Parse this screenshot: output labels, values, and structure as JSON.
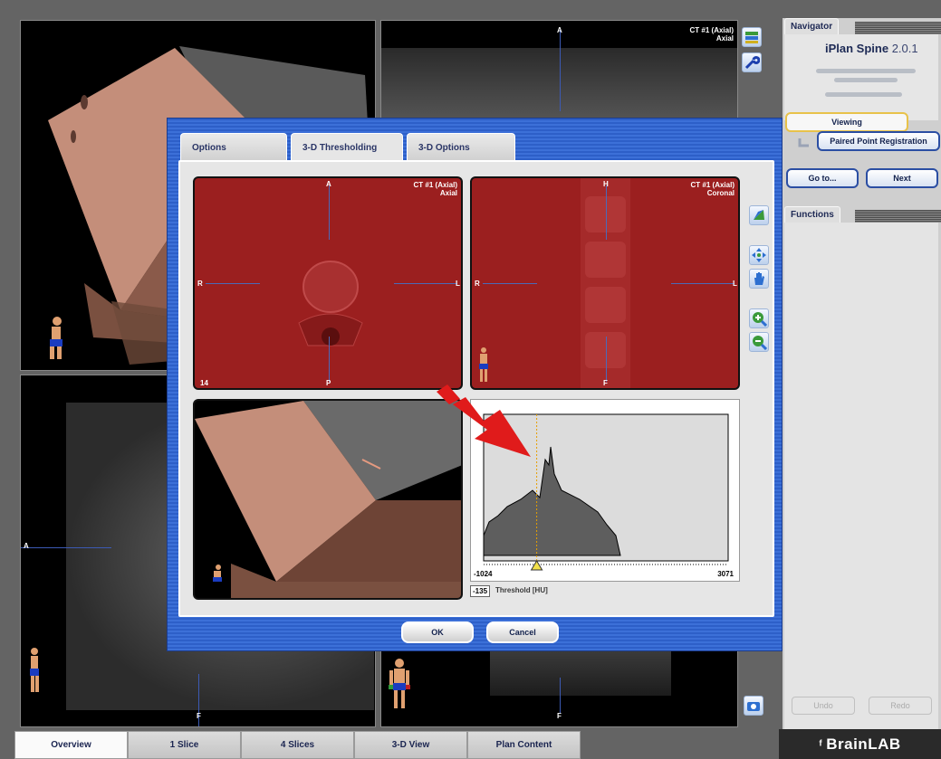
{
  "app": {
    "title": "iPlan Spine",
    "version": "2.0.1",
    "brand": "BrainLAB"
  },
  "viewports": {
    "top_right": {
      "series": "CT #1 (Axial)",
      "orientation": "Axial",
      "top_marker": "A"
    },
    "bottom_left": {
      "left_marker": "A",
      "bottom_marker": "F"
    },
    "bottom_right": {
      "bottom_marker": "F"
    }
  },
  "navigator": {
    "tab_label": "Navigator",
    "step_current": "Viewing",
    "step_next": "Paired Point Registration",
    "goto_label": "Go to...",
    "next_label": "Next"
  },
  "functions": {
    "tab_label": "Functions",
    "undo_label": "Undo",
    "redo_label": "Redo"
  },
  "bottom_tabs": [
    {
      "label": "Overview",
      "active": true
    },
    {
      "label": "1 Slice",
      "active": false
    },
    {
      "label": "4 Slices",
      "active": false
    },
    {
      "label": "3-D View",
      "active": false
    },
    {
      "label": "Plan Content",
      "active": false
    }
  ],
  "dialog": {
    "tabs": [
      {
        "label": "Options",
        "active": false
      },
      {
        "label": "3-D Thresholding",
        "active": true
      },
      {
        "label": "3-D Options",
        "active": false
      }
    ],
    "axial_view": {
      "series": "CT #1 (Axial)",
      "orientation": "Axial",
      "markers": {
        "top": "A",
        "bottom": "P",
        "left": "R",
        "right": "L"
      },
      "slice_number": "14"
    },
    "coronal_view": {
      "series": "CT #1 (Axial)",
      "orientation": "Coronal",
      "markers": {
        "top": "H",
        "bottom": "F",
        "left": "R",
        "right": "L"
      }
    },
    "histogram": {
      "min_label": "-1024",
      "max_label": "3071",
      "threshold_value": "-135",
      "threshold_label": "Threshold [HU]",
      "threshold_position": 0.217
    },
    "ok_label": "OK",
    "cancel_label": "Cancel"
  },
  "colors": {
    "dialog_blue": "#3466cf",
    "threshold_mask": "#9b1f1f",
    "bone_render": "#c08a76",
    "annotation_arrow": "#e01b1b",
    "threshold_line": "#e6a000"
  }
}
